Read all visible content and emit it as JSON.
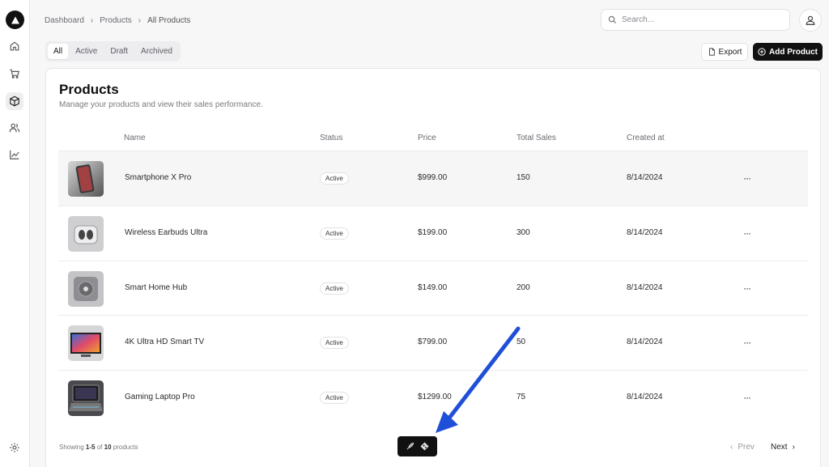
{
  "breadcrumb": {
    "items": [
      "Dashboard",
      "Products",
      "All Products"
    ]
  },
  "search": {
    "placeholder": "Search..."
  },
  "tabs": [
    "All",
    "Active",
    "Draft",
    "Archived"
  ],
  "actions": {
    "export_label": "Export",
    "add_label": "Add Product"
  },
  "card": {
    "title": "Products",
    "subtitle": "Manage your products and view their sales performance."
  },
  "table": {
    "headers": [
      "Name",
      "Status",
      "Price",
      "Total Sales",
      "Created at"
    ],
    "rows": [
      {
        "name": "Smartphone X Pro",
        "status": "Active",
        "price": "$999.00",
        "sales": "150",
        "created": "8/14/2024",
        "image": "smartphone"
      },
      {
        "name": "Wireless Earbuds Ultra",
        "status": "Active",
        "price": "$199.00",
        "sales": "300",
        "created": "8/14/2024",
        "image": "earbuds"
      },
      {
        "name": "Smart Home Hub",
        "status": "Active",
        "price": "$149.00",
        "sales": "200",
        "created": "8/14/2024",
        "image": "hub"
      },
      {
        "name": "4K Ultra HD Smart TV",
        "status": "Active",
        "price": "$799.00",
        "sales": "50",
        "created": "8/14/2024",
        "image": "tv"
      },
      {
        "name": "Gaming Laptop Pro",
        "status": "Active",
        "price": "$1299.00",
        "sales": "75",
        "created": "8/14/2024",
        "image": "laptop"
      }
    ],
    "more_glyph": "···"
  },
  "footer": {
    "showing_prefix": "Showing",
    "range": "1-5",
    "of_word": "of",
    "total": "10",
    "suffix": "products",
    "prev_label": "Prev",
    "next_label": "Next"
  },
  "sidebar": {
    "items": [
      "home-icon",
      "cart-icon",
      "package-icon",
      "users-icon",
      "chart-icon"
    ],
    "bottom": "settings-icon"
  },
  "colors": {
    "accent": "#111111",
    "annotation_arrow": "#1f4fd8"
  }
}
